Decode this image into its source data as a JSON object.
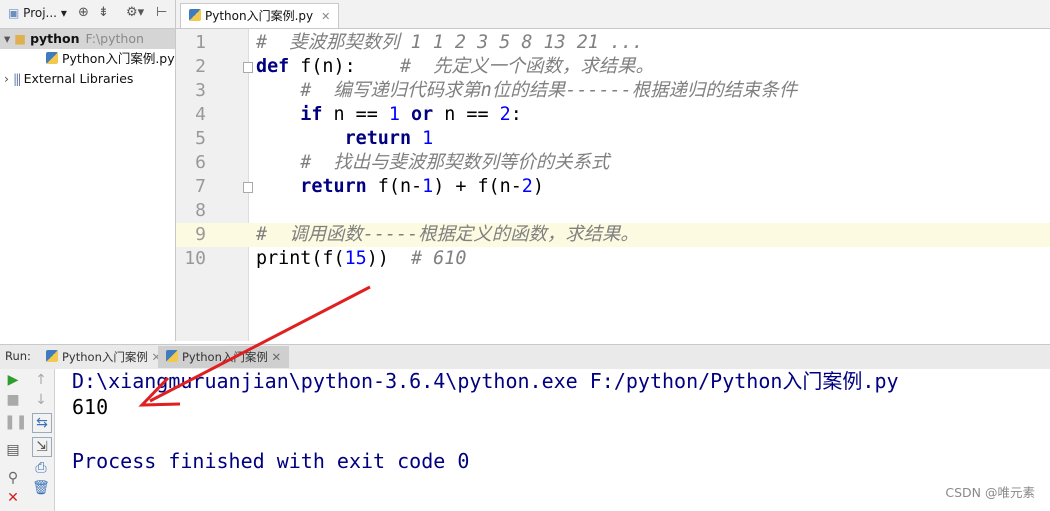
{
  "project_panel": {
    "title": "Proj...",
    "root": {
      "name": "python",
      "path": "F:\\python"
    },
    "file": "Python入门案例.py",
    "external_libraries": "External Libraries"
  },
  "editor": {
    "tab_label": "Python入门案例.py",
    "line_numbers": [
      "1",
      "2",
      "3",
      "4",
      "5",
      "6",
      "7",
      "8",
      "9",
      "10"
    ],
    "lines": [
      "#  斐波那契数列 1 1 2 3 5 8 13 21 ...",
      "def f(n):    #  先定义一个函数，求结果。",
      "    #  编写递归代码求第n位的结果------根据递归的结束条件",
      "    if n == 1 or n == 2:",
      "        return 1",
      "    #  找出与斐波那契数列等价的关系式",
      "    return f(n-1) + f(n-2)",
      "",
      "#  调用函数-----根据定义的函数，求结果。",
      "print(f(15))  # 610"
    ]
  },
  "run_panel": {
    "label": "Run:",
    "tabs": [
      "Python入门案例",
      "Python入门案例"
    ],
    "console": [
      "D:\\xiangmuruanjian\\python-3.6.4\\python.exe F:/python/Python入门案例.py",
      "610",
      "",
      "Process finished with exit code 0"
    ]
  },
  "watermark": "CSDN @唯元素",
  "colors": {
    "keyword": "#000080",
    "number": "#0000ff",
    "comment": "#808080",
    "arrow": "#e02020",
    "console_system": "#000080"
  }
}
